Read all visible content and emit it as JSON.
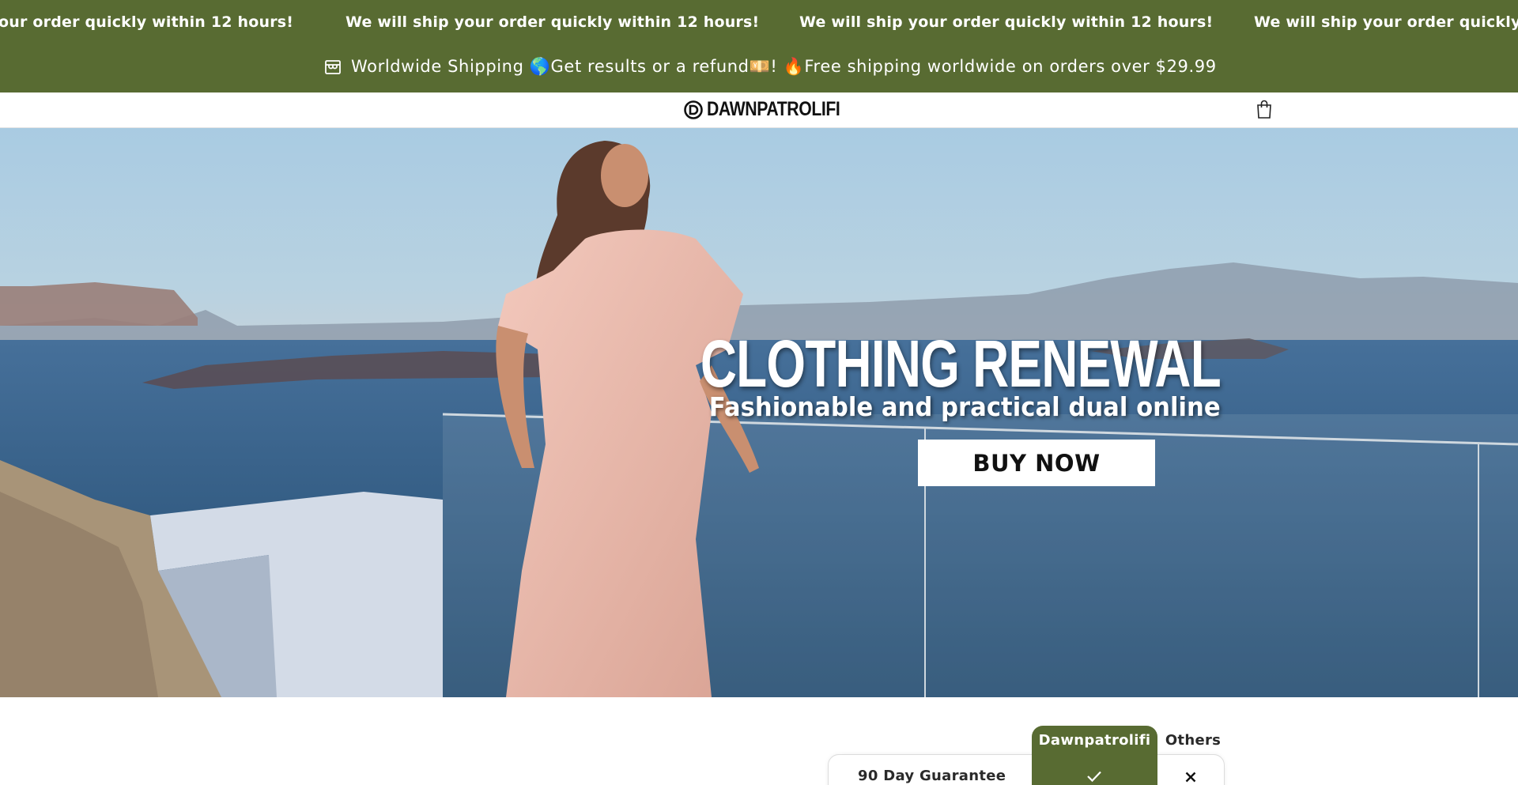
{
  "marquee": {
    "items": [
      "our order quickly within 12 hours!",
      "We will ship your order quickly within 12 hours!",
      "We will ship your order quickly within 12 hours!",
      "We will ship your order quickly w"
    ]
  },
  "announcement": {
    "icon": "store-icon",
    "text": "Worldwide Shipping 🌎Get results or a refund💴! 🔥Free shipping worldwide on orders over $29.99"
  },
  "header": {
    "logo_text": "DAWNPATROLIFI",
    "cart_icon": "shopping-bag-icon"
  },
  "hero": {
    "headline": "CLOTHING RENEWAL",
    "subheadline": "Fashionable and practical dual online",
    "button_label": "BUY NOW"
  },
  "comparison": {
    "brand_column": "Dawnpatrolifi",
    "other_column": "Others",
    "rows": [
      {
        "label": "90 Day Guarantee",
        "brand": "check-icon",
        "other": "cross-icon"
      }
    ]
  },
  "colors": {
    "accent": "#586b32",
    "white": "#ffffff"
  }
}
